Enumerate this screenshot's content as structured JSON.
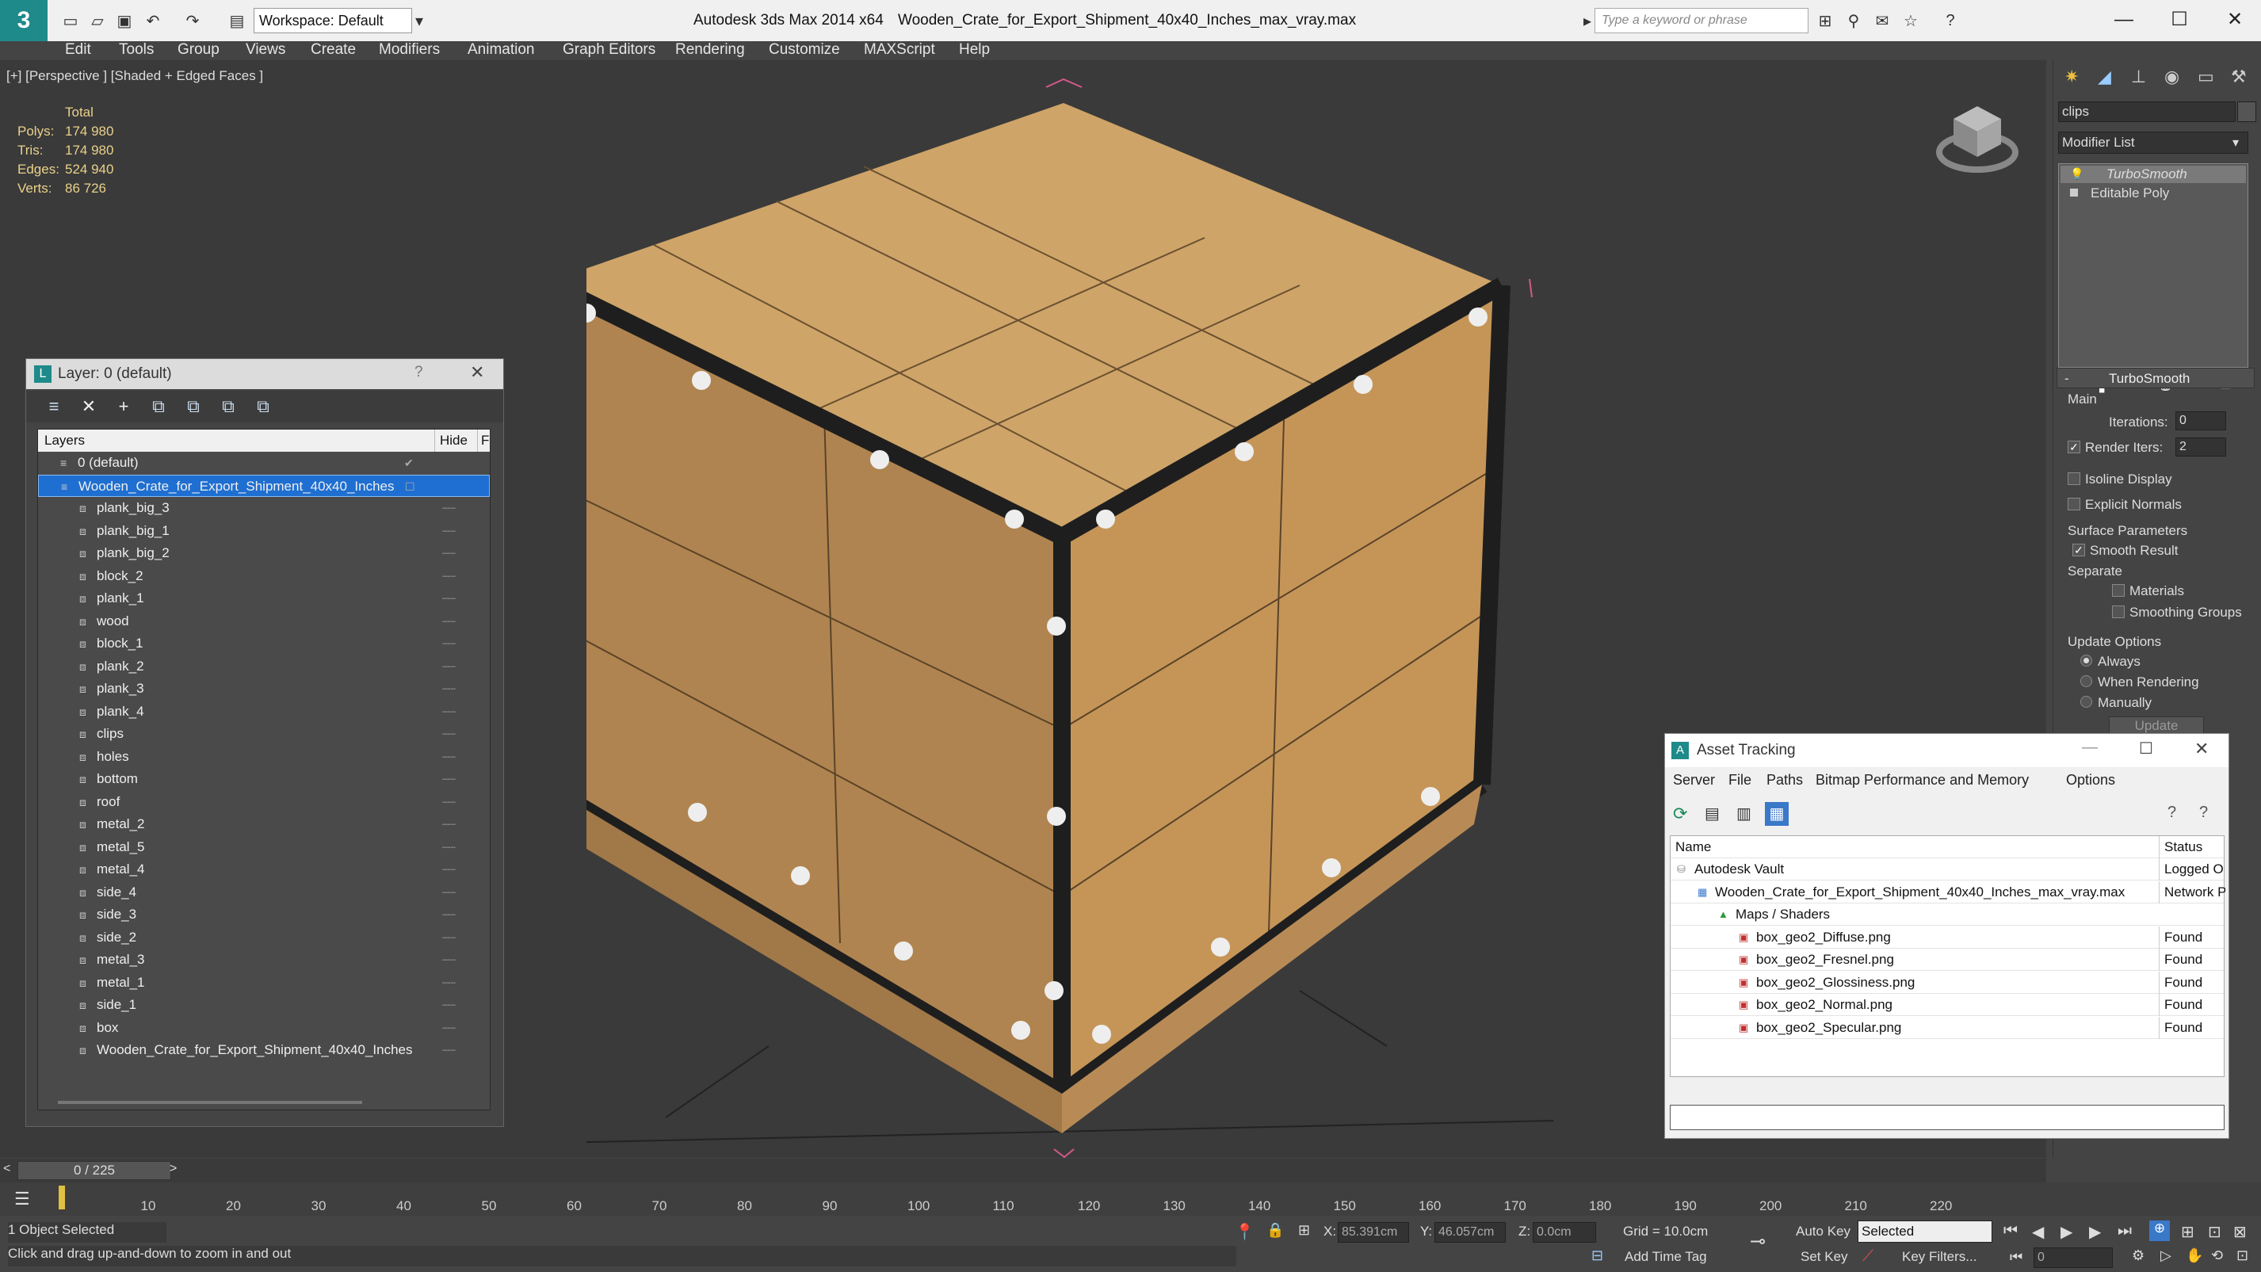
{
  "titlebar": {
    "app_title": "Autodesk 3ds Max  2014 x64",
    "file_title": "Wooden_Crate_for_Export_Shipment_40x40_Inches_max_vray.max",
    "workspace": "Workspace: Default",
    "search_placeholder": "Type a keyword or phrase"
  },
  "menu": [
    "Edit",
    "Tools",
    "Group",
    "Views",
    "Create",
    "Modifiers",
    "Animation",
    "Graph Editors",
    "Rendering",
    "Customize",
    "MAXScript",
    "Help"
  ],
  "viewport": {
    "label": "[+] [Perspective ] [Shaded + Edged Faces ]",
    "stats_header": "Total",
    "stats": [
      {
        "label": "Polys:",
        "value": "174 980"
      },
      {
        "label": "Tris:",
        "value": "174 980"
      },
      {
        "label": "Edges:",
        "value": "524 940"
      },
      {
        "label": "Verts:",
        "value": "86 726"
      }
    ]
  },
  "layer_window": {
    "title": "Layer: 0 (default)",
    "help": "?",
    "col_layers": "Layers",
    "col_hide": "Hide",
    "col_fr": "Fr",
    "rows": [
      "0 (default)",
      "Wooden_Crate_for_Export_Shipment_40x40_Inches",
      "plank_big_3",
      "plank_big_1",
      "plank_big_2",
      "block_2",
      "plank_1",
      "wood",
      "block_1",
      "plank_2",
      "plank_3",
      "plank_4",
      "clips",
      "holes",
      "bottom",
      "roof",
      "metal_2",
      "metal_5",
      "metal_4",
      "side_4",
      "side_3",
      "side_2",
      "metal_3",
      "metal_1",
      "side_1",
      "box",
      "Wooden_Crate_for_Export_Shipment_40x40_Inches"
    ]
  },
  "command_panel": {
    "object_name": "clips",
    "modifier_list": "Modifier List",
    "stack": [
      "TurboSmooth",
      "Editable Poly"
    ],
    "rollout_title": "TurboSmooth",
    "main": "Main",
    "iterations_label": "Iterations:",
    "iterations_value": "0",
    "render_iters_label": "Render Iters:",
    "render_iters_value": "2",
    "isoline": "Isoline Display",
    "explicit_normals": "Explicit Normals",
    "surface_params": "Surface Parameters",
    "smooth_result": "Smooth Result",
    "separate": "Separate",
    "materials": "Materials",
    "smoothing_groups": "Smoothing Groups",
    "update_options": "Update Options",
    "always": "Always",
    "when_rendering": "When Rendering",
    "manually": "Manually",
    "update_button": "Update"
  },
  "asset_tracking": {
    "title": "Asset Tracking",
    "menus": [
      "Server",
      "File",
      "Paths",
      "Bitmap Performance and Memory",
      "Options"
    ],
    "col_name": "Name",
    "col_status": "Status",
    "rows": [
      {
        "name": "Autodesk Vault",
        "status": "Logged O",
        "indent": 0
      },
      {
        "name": "Wooden_Crate_for_Export_Shipment_40x40_Inches_max_vray.max",
        "status": "Network P",
        "indent": 1
      },
      {
        "name": "Maps / Shaders",
        "status": "",
        "indent": 2
      },
      {
        "name": "box_geo2_Diffuse.png",
        "status": "Found",
        "indent": 3
      },
      {
        "name": "box_geo2_Fresnel.png",
        "status": "Found",
        "indent": 3
      },
      {
        "name": "box_geo2_Glossiness.png",
        "status": "Found",
        "indent": 3
      },
      {
        "name": "box_geo2_Normal.png",
        "status": "Found",
        "indent": 3
      },
      {
        "name": "box_geo2_Specular.png",
        "status": "Found",
        "indent": 3
      }
    ]
  },
  "timeline": {
    "frame": "0 / 225",
    "ticks": [
      "10",
      "20",
      "30",
      "40",
      "50",
      "60",
      "70",
      "80",
      "90",
      "100",
      "110",
      "120",
      "130",
      "140",
      "150",
      "160",
      "170",
      "180",
      "190",
      "200",
      "210",
      "220"
    ]
  },
  "status": {
    "selection": "1 Object Selected",
    "prompt": "Click and drag up-and-down to zoom in and out",
    "x_label": "X:",
    "x_value": "85.391cm",
    "y_label": "Y:",
    "y_value": "46.057cm",
    "z_label": "Z:",
    "z_value": "0.0cm",
    "grid": "Grid = 10.0cm",
    "auto_key": "Auto Key",
    "selected": "Selected",
    "set_key": "Set Key",
    "key_filters": "Key Filters...",
    "add_time_tag": "Add Time Tag",
    "frame_value": "0"
  },
  "colors": {
    "selection_blue": "#1e6fd1",
    "wood": "#c99b5e",
    "metal": "#2a2a2a",
    "bbox_pink": "#d35a8a"
  }
}
